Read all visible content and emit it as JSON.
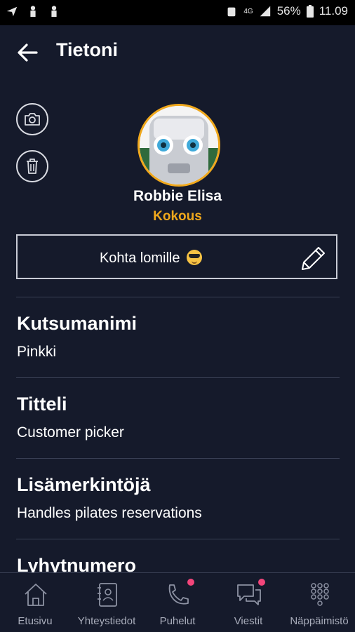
{
  "statusbar": {
    "signal_label": "4G",
    "battery": "56%",
    "time": "11.09"
  },
  "header": {
    "title": "Tietoni"
  },
  "profile": {
    "name": "Robbie Elisa",
    "presence": "Kokous",
    "status_message": "Kohta lomille"
  },
  "fields": [
    {
      "label": "Kutsumanimi",
      "value": "Pinkki"
    },
    {
      "label": "Titteli",
      "value": "Customer picker"
    },
    {
      "label": "Lisämerkintöjä",
      "value": "Handles pilates reservations"
    },
    {
      "label": "Lyhytnumero",
      "value": ""
    }
  ],
  "nav": {
    "items": [
      {
        "label": "Etusivu",
        "icon": "home-icon"
      },
      {
        "label": "Yhteystiedot",
        "icon": "contacts-icon"
      },
      {
        "label": "Puhelut",
        "icon": "phone-icon"
      },
      {
        "label": "Viestit",
        "icon": "chat-icon"
      },
      {
        "label": "Näppäimistö",
        "icon": "keypad-icon"
      }
    ]
  },
  "colors": {
    "background": "#151a2b",
    "accent": "#f0a81c",
    "badge": "#f2457a"
  }
}
